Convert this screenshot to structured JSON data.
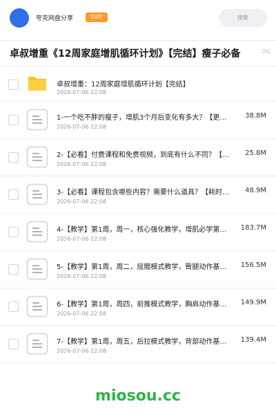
{
  "header": {
    "site_name": "夸克网盘分享",
    "badge": "SVIP",
    "search_placeholder": "搜索"
  },
  "share": {
    "title": "卓叔增重《12周家庭增肌循环计划》【完结】瘦子必备",
    "title_tail": "DG"
  },
  "files": [
    {
      "type": "folder",
      "name": "卓叔增重：12周家庭增肌循环计划【完结】",
      "date": "2026-07-06 22:08",
      "size": ""
    },
    {
      "type": "file",
      "name": "1-一个吃不胖的瘦子，增肌3个月后变化有多大？【更…",
      "date": "2026-07-06 22:08",
      "size": "38.8M"
    },
    {
      "type": "file",
      "name": "2-【必看】付费课程和免费视频，到底有什么不同？【…",
      "date": "2026-07-06 22:08",
      "size": "25.8M"
    },
    {
      "type": "file",
      "name": "3-【必看】课程包含哪些内容？需要什么道具？【耗时…",
      "date": "2026-07-06 22:08",
      "size": "48.9M"
    },
    {
      "type": "file",
      "name": "4-【教学】第1周，周一，核心强化教学，增肌必学第…",
      "date": "2026-07-06 22:08",
      "size": "183.7M"
    },
    {
      "type": "file",
      "name": "5-【教学】第1周，周二，屈髋模式教学，臀腿动作基…",
      "date": "2026-07-06 22:08",
      "size": "156.5M"
    },
    {
      "type": "file",
      "name": "6-【教学】第1周，周四，前推模式教学，胸肩动作基…",
      "date": "2026-07-06 22:08",
      "size": "149.9M"
    },
    {
      "type": "file",
      "name": "7-【教学】第1周，周五，后拉模式教学，背部动作基…",
      "date": "2026-07-06 22:08",
      "size": "139.4M"
    }
  ],
  "footer": {
    "watermark": "miosou.cc"
  },
  "colors": {
    "avatar": "#2f6fe9",
    "badge": "#ff9a2a",
    "folder": "#ffc11a",
    "watermark": "#2fb34a"
  }
}
